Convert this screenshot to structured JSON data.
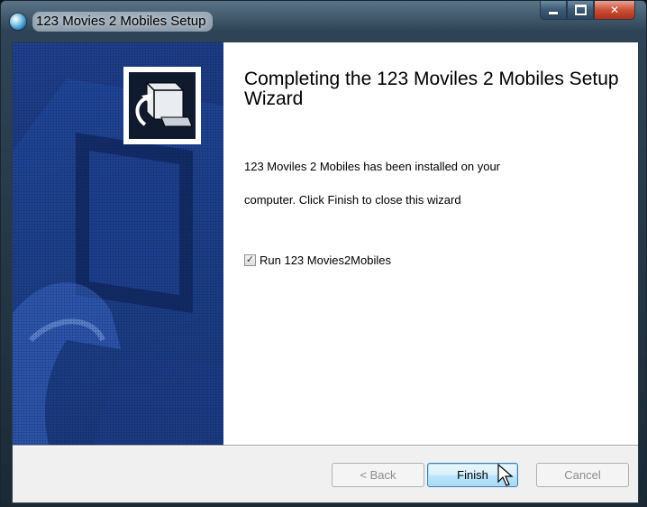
{
  "window": {
    "title": "123 Movies 2 Mobiles Setup",
    "controls": {
      "minimize": "minimize-icon",
      "maximize": "maximize-icon",
      "close": "✕"
    }
  },
  "content": {
    "heading": "Completing the 123 Moviles 2 Mobiles Setup Wizard",
    "desc_line1": "123 Moviles 2 Mobiles has been installed on your",
    "desc_line2": "computer. Click Finish to close this wizard",
    "checkbox": {
      "label": "Run 123 Movies2Mobiles",
      "checked": true,
      "mark": "✓"
    }
  },
  "buttons": {
    "back": "< Back",
    "finish": "Finish",
    "cancel": "Cancel"
  },
  "colors": {
    "banner": "#183474",
    "finish_border": "#3c7fb1",
    "close": "#cc4f37"
  }
}
